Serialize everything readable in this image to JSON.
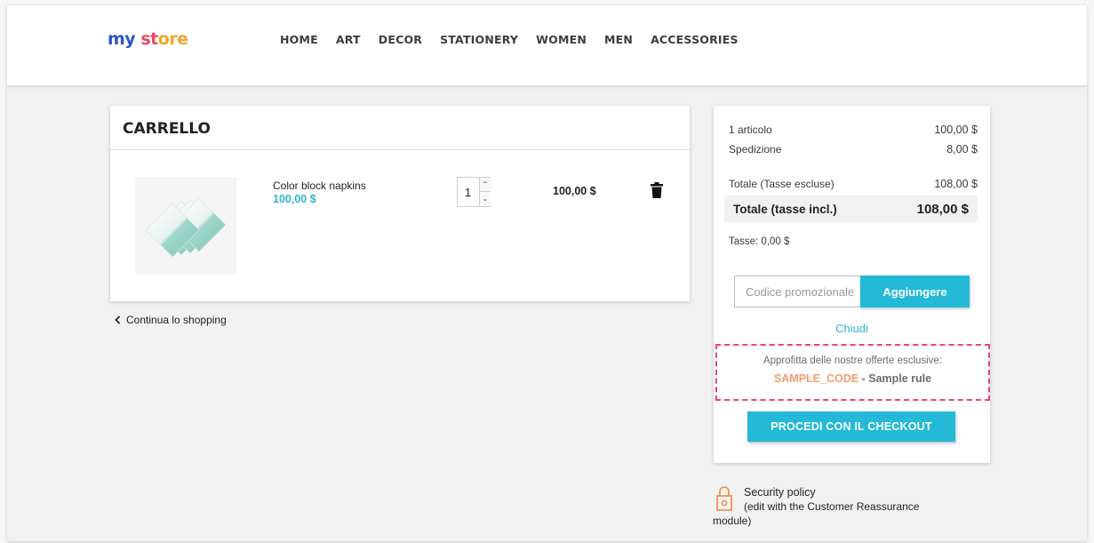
{
  "header": {
    "logo": {
      "part1": "my",
      "part2": " ",
      "part3": "st",
      "part4": "ore"
    },
    "nav": [
      "HOME",
      "ART",
      "DECOR",
      "STATIONERY",
      "WOMEN",
      "MEN",
      "ACCESSORIES"
    ]
  },
  "cart": {
    "title": "CARRELLO",
    "item": {
      "name": "Color block napkins",
      "price": "100,00 $",
      "quantity": "1",
      "line_total": "100,00 $"
    },
    "continue_label": "Continua lo shopping"
  },
  "summary": {
    "items_label": "1 articolo",
    "items_value": "100,00 $",
    "shipping_label": "Spedizione",
    "shipping_value": "8,00 $",
    "subtotal_label": "Totale (Tasse escluse)",
    "subtotal_value": "108,00 $",
    "total_label": "Totale (tasse incl.)",
    "total_value": "108,00 $",
    "taxes": "Tasse: 0,00 $",
    "promo_placeholder": "Codice promozionale",
    "promo_button": "Aggiungere",
    "close_label": "Chiudi",
    "offers_intro": "Approfitta delle nostre offerte esclusive:",
    "offer_code": "SAMPLE_CODE",
    "offer_sep": " - ",
    "offer_rule": "Sample rule",
    "checkout_button": "PROCEDI CON IL CHECKOUT"
  },
  "reassurance": {
    "title": "Security policy",
    "desc_line1": "(edit with the Customer Reassurance",
    "desc_line2": "module)"
  },
  "colors": {
    "accent": "#24b9d7",
    "offer_border": "#e8457a",
    "offer_code": "#f39d72",
    "lock_icon": "#f08a4b"
  }
}
